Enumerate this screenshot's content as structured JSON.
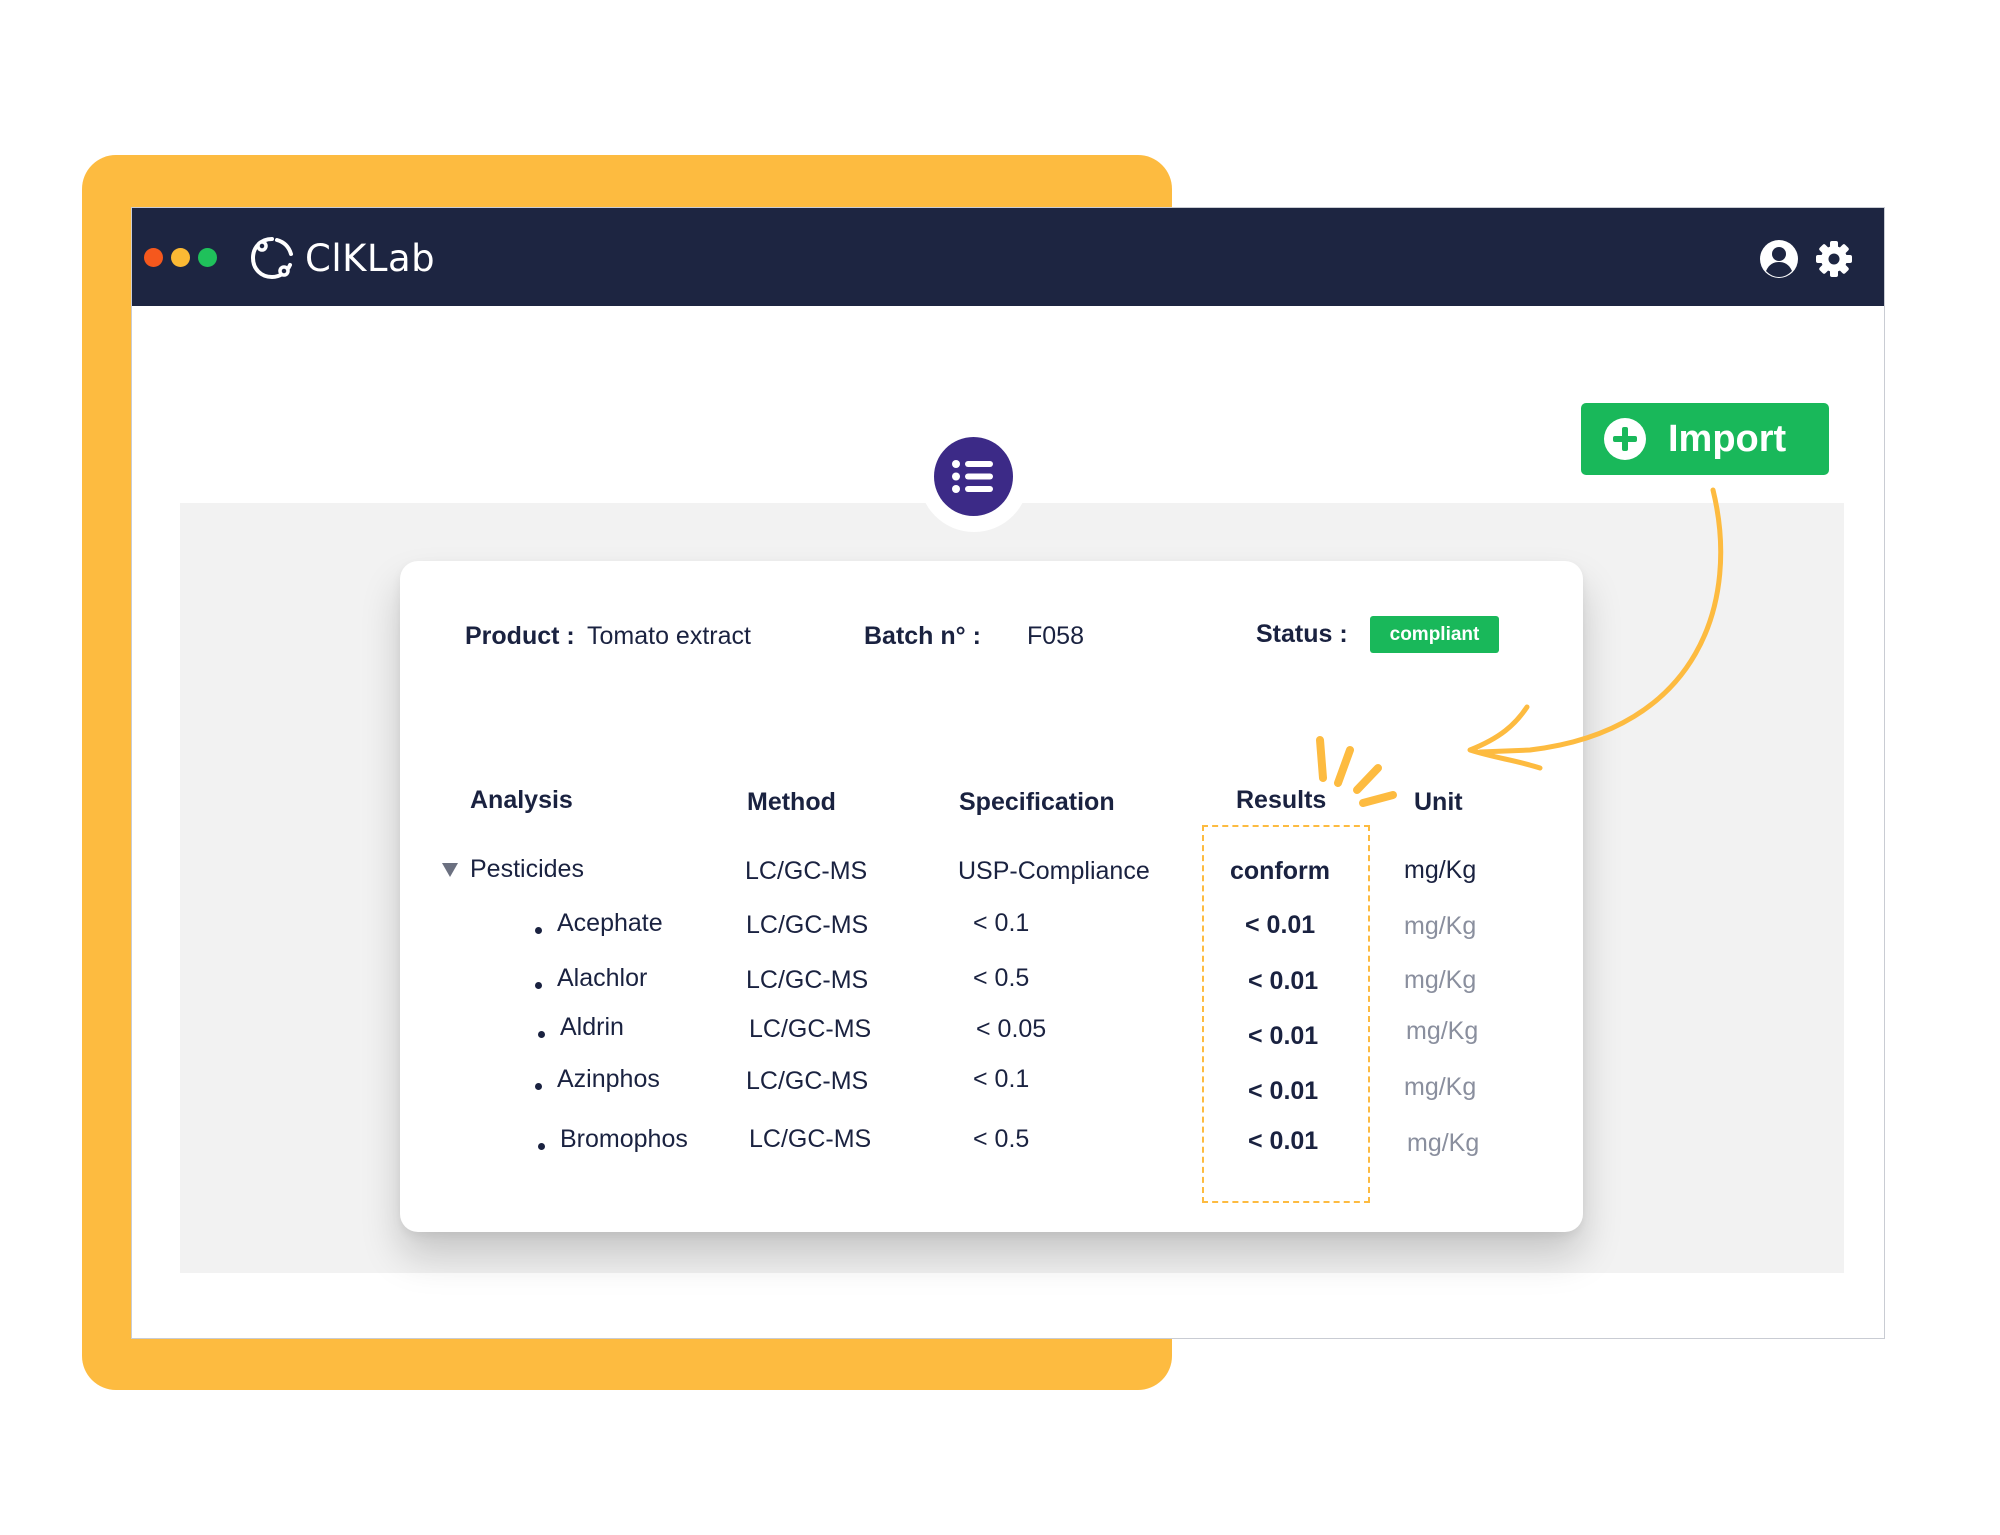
{
  "app": {
    "name": "ClKLab",
    "window_dots": [
      "#f5581d",
      "#fbb934",
      "#1fc15b"
    ]
  },
  "toolbar": {
    "user_icon": "user-icon",
    "settings_icon": "gear-icon",
    "list_icon": "list-icon",
    "import_label": "Import",
    "import_icon": "plus-circle-icon"
  },
  "record": {
    "product_label": "Product :",
    "product_value": "Tomato extract",
    "batch_label": "Batch n° :",
    "batch_value": "F058",
    "status_label": "Status :",
    "status_value": "compliant"
  },
  "table": {
    "headers": {
      "analysis": "Analysis",
      "method": "Method",
      "specification": "Specification",
      "results": "Results",
      "unit": "Unit"
    },
    "group": {
      "name": "Pesticides",
      "method": "LC/GC-MS",
      "specification": "USP-Compliance",
      "result": "conform",
      "unit": "mg/Kg"
    },
    "rows": [
      {
        "analysis": "Acephate",
        "method": "LC/GC-MS",
        "specification": "< 0.1",
        "result": "< 0.01",
        "unit": "mg/Kg"
      },
      {
        "analysis": "Alachlor",
        "method": "LC/GC-MS",
        "specification": "< 0.5",
        "result": "< 0.01",
        "unit": "mg/Kg"
      },
      {
        "analysis": "Aldrin",
        "method": "LC/GC-MS",
        "specification": "< 0.05",
        "result": "< 0.01",
        "unit": "mg/Kg"
      },
      {
        "analysis": "Azinphos",
        "method": "LC/GC-MS",
        "specification": "< 0.1",
        "result": "< 0.01",
        "unit": "mg/Kg"
      },
      {
        "analysis": "Bromophos",
        "method": "LC/GC-MS",
        "specification": "< 0.5",
        "result": "< 0.01",
        "unit": "mg/Kg"
      }
    ]
  },
  "colors": {
    "navy": "#1d2541",
    "accent_yellow": "#fdbb40",
    "success_green": "#19b85a",
    "purple": "#3c2a87"
  }
}
